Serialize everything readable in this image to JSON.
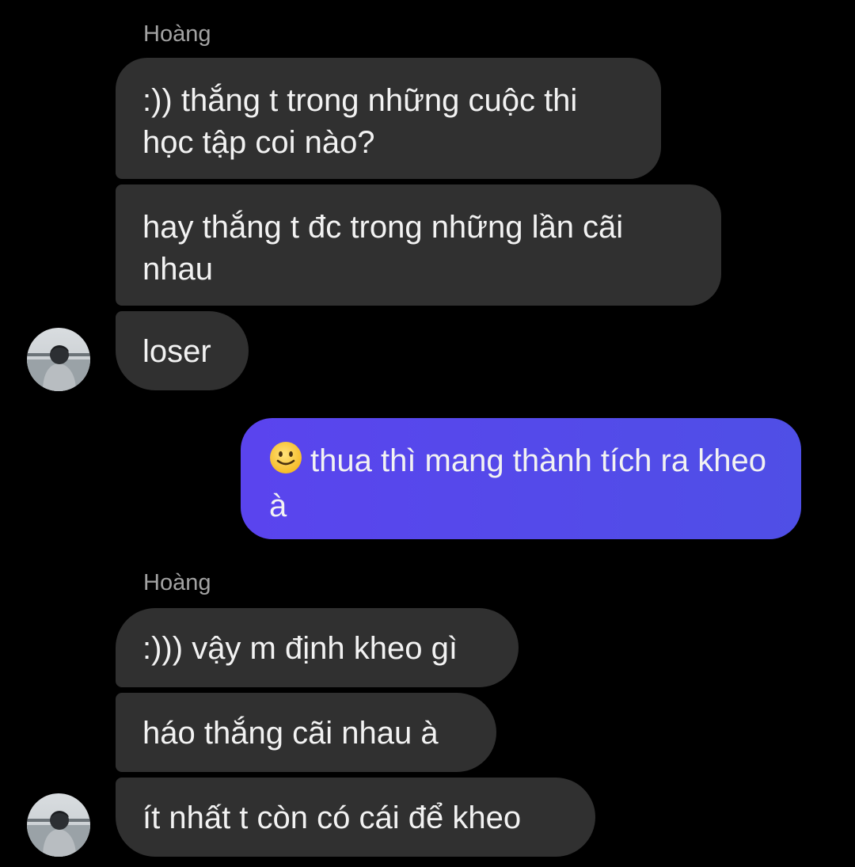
{
  "conversation": {
    "groups": [
      {
        "sender": "Hoàng",
        "messages": [
          ":)) thắng t trong những cuộc thi học tập coi nào?",
          "hay thắng t đc trong những lần cãi nhau",
          "loser"
        ]
      },
      {
        "sender": "",
        "messages": [
          "thua thì mang thành tích ra kheo à"
        ]
      },
      {
        "sender": "Hoàng",
        "messages": [
          ":))) vậy m định kheo gì",
          "háo thắng cãi nhau à",
          "ít nhất t còn có cái để kheo"
        ]
      }
    ]
  },
  "icons": {
    "outgoing_emoji": "slightly-smiling-face-icon",
    "avatar": "user-avatar-photo"
  },
  "colors": {
    "background": "#000000",
    "incoming_bubble": "#303030",
    "outgoing_bubble": "#5048EA",
    "sender_name": "#A3A3A3",
    "message_text": "#F2F2F2"
  }
}
